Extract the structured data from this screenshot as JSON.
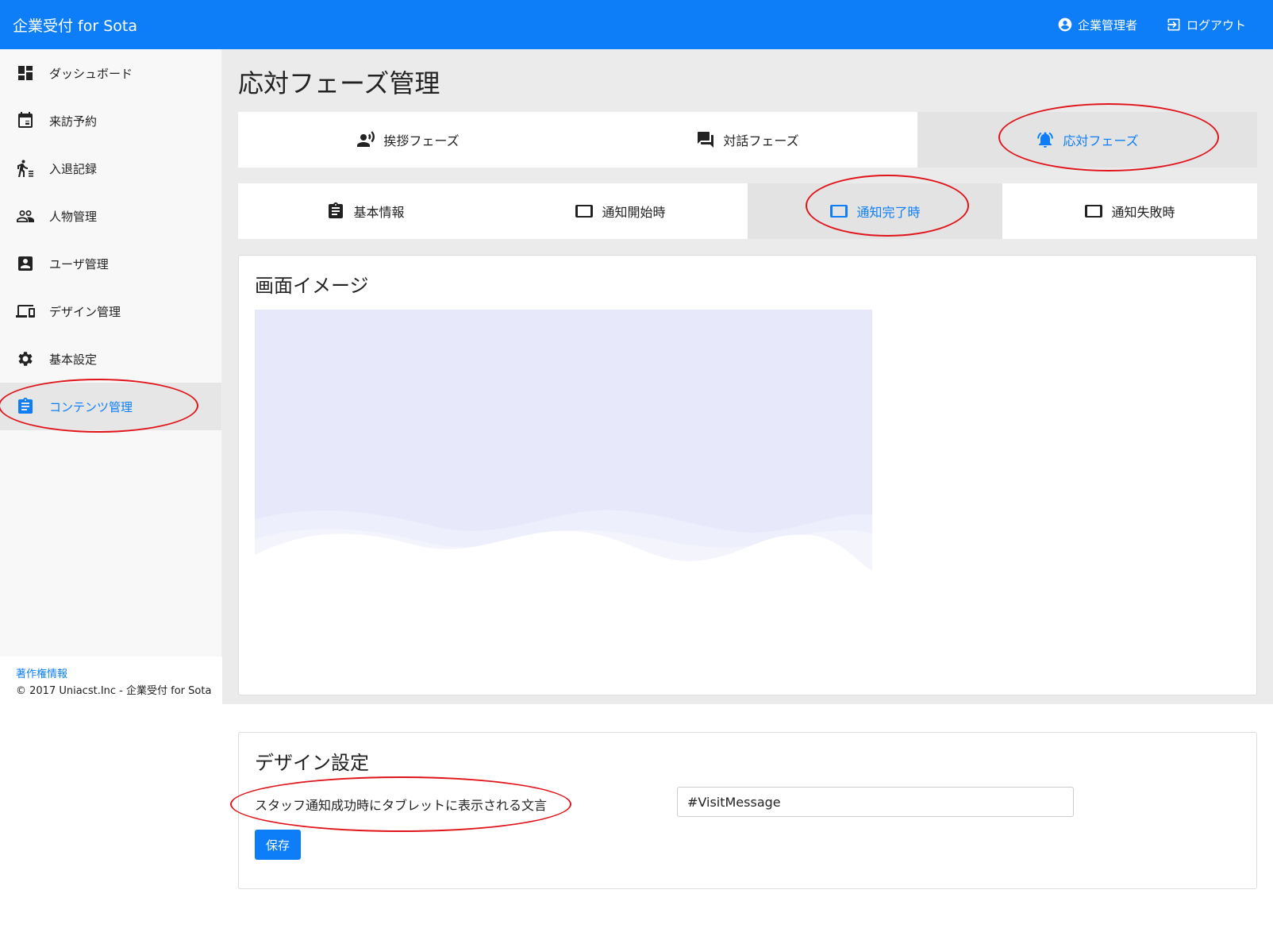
{
  "header": {
    "brand": "企業受付 for Sota",
    "user_label": "企業管理者",
    "logout_label": "ログアウト"
  },
  "sidebar": {
    "items": [
      {
        "label": "ダッシュボード",
        "icon": "dashboard-icon"
      },
      {
        "label": "来訪予約",
        "icon": "calendar-icon"
      },
      {
        "label": "入退記録",
        "icon": "walk-icon"
      },
      {
        "label": "人物管理",
        "icon": "people-icon"
      },
      {
        "label": "ユーザ管理",
        "icon": "account-box-icon"
      },
      {
        "label": "デザイン管理",
        "icon": "devices-icon"
      },
      {
        "label": "基本設定",
        "icon": "gear-icon"
      },
      {
        "label": "コンテンツ管理",
        "icon": "clipboard-icon",
        "active": true
      }
    ],
    "footer": {
      "copyright_link": "著作権情報",
      "copyright_text": "© 2017 Uniacst.Inc - 企業受付 for Sota"
    }
  },
  "main": {
    "title": "応対フェーズ管理",
    "phase_tabs": [
      {
        "label": "挨拶フェーズ",
        "icon": "voice-icon"
      },
      {
        "label": "対話フェーズ",
        "icon": "chat-icon"
      },
      {
        "label": "応対フェーズ",
        "icon": "bell-icon",
        "active": true
      }
    ],
    "sub_tabs": [
      {
        "label": "基本情報",
        "icon": "clipboard-icon"
      },
      {
        "label": "通知開始時",
        "icon": "tablet-icon"
      },
      {
        "label": "通知完了時",
        "icon": "tablet-icon",
        "active": true
      },
      {
        "label": "通知失敗時",
        "icon": "tablet-icon"
      }
    ],
    "preview_card": {
      "title": "画面イメージ"
    },
    "design_card": {
      "title": "デザイン設定",
      "field_label": "スタッフ通知成功時にタブレットに表示される文言",
      "field_value": "#VisitMessage",
      "save_label": "保存"
    }
  },
  "colors": {
    "accent": "#0d7ef7",
    "annotation": "#e0141a",
    "preview_bg": "#e7e9fb"
  }
}
